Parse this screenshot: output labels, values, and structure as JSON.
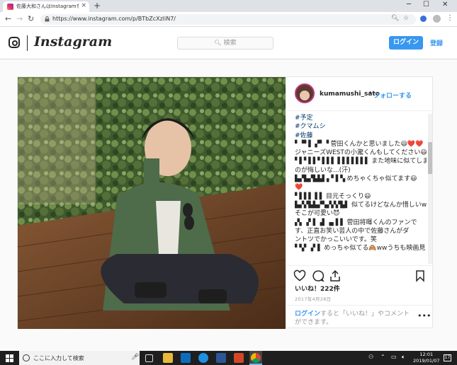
{
  "browser": {
    "tab_title": "佐藤大和さんはInstagramを利用し",
    "tab_close": "×",
    "new_tab": "+",
    "url": "https://www.instagram.com/p/BTbZcXzliN7/",
    "minimize": "─",
    "maximize": "☐",
    "close": "✕"
  },
  "header": {
    "wordmark": "Instagram",
    "search_placeholder": "検索",
    "login_label": "ログイン",
    "signup_label": "登録"
  },
  "post": {
    "username": "kumamushi_sato",
    "separator": "•",
    "follow_label": "フォローする",
    "comments": [
      {
        "text": "#予定",
        "type": "hashtag"
      },
      {
        "text": "#クマムシ",
        "type": "hashtag"
      },
      {
        "text": "#佐藤",
        "type": "hashtag"
      },
      {
        "user": "▘▝▘▌ ▞▘▝",
        "text": "菅田くんかと思いました😃❤️❤️"
      },
      {
        "text": "ジャニーズWESTの小瀧くんもしてください😃😈"
      },
      {
        "user": "▘▌▘▌▌▘▌▌▌ ▌▌▌▌▌▌▌",
        "text": "また地味に似てしまっている"
      },
      {
        "text": "のが悔しいな...(汗)"
      },
      {
        "user": "▙▞▙▞▙▙▌▖▘▌▚",
        "text": "めちゃくちゃ似てます😃"
      },
      {
        "text": "❤️"
      },
      {
        "user": "▘▌▌▌ ▌▌",
        "text": "目元そっくり😃"
      },
      {
        "user": "▙▞▞▙▙▞▚▞▞▞▙▌",
        "text": "似てるけどなんか惜しいwww"
      },
      {
        "text": "そこが可愛い😈"
      },
      {
        "user": "▞▖▗▘▌▗▌▗▖▌▌",
        "text": "菅田将暉くんのファンで"
      },
      {
        "text": "す、正直お笑い芸人の中で佐藤さんがダ"
      },
      {
        "text": "ントツでかっこいいです。笑"
      },
      {
        "user": "▘▚▘▗▘▌",
        "text": "めっちゃ似てる🙈wwうちも映画見"
      }
    ],
    "likes": "いいね！222件",
    "date": "2017年4月28日",
    "login_link": "ログイン",
    "login_rest": "すると「いいね！」やコメントができます。",
    "more": "•••"
  },
  "taskbar": {
    "search_text": "ここに入力して検索",
    "time": "12:01",
    "date": "2019/01/07",
    "notification_count": "17"
  },
  "colors": {
    "accent": "#3897f0",
    "tab_strip": "#dee1e6",
    "taskbar": "#1f1f1f"
  }
}
